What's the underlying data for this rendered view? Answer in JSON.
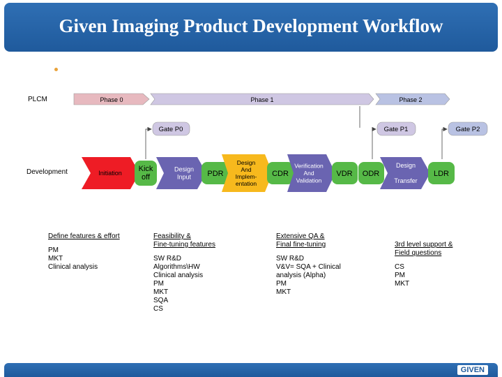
{
  "title": "Given Imaging Product Development Workflow",
  "logo_text": "GIVEN",
  "rows": {
    "plcm": "PLCM",
    "development": "Development"
  },
  "phases": [
    "Phase 0",
    "Phase 1",
    "Phase 2"
  ],
  "gates": [
    "Gate P0",
    "Gate P1",
    "Gate P2"
  ],
  "steps": {
    "initiation": "Initiation",
    "kick_off": "Kick\noff",
    "design_input": "Design\nInput",
    "pdr": "PDR",
    "design_impl": "Design\nAnd\nImplem-\nentation",
    "cdr": "CDR",
    "vv": "Verification\nAnd\nValidation",
    "vdr": "VDR",
    "odr": "ODR",
    "design_transfer": "Design\n \nTransfer",
    "ldr": "LDR"
  },
  "columns": [
    {
      "heading": "Define features & effort",
      "items": [
        "PM",
        "MKT",
        "Clinical analysis"
      ]
    },
    {
      "heading": "Feasibility &\nFine-tuning  features",
      "items": [
        "SW R&D",
        "Algorithms\\HW",
        "Clinical analysis",
        "PM",
        "MKT",
        "SQA",
        "CS"
      ]
    },
    {
      "heading": "Extensive QA &\nFinal fine-tuning",
      "items": [
        "SW R&D",
        "V&V= SQA + Clinical",
        "analysis (Alpha)",
        "PM",
        "MKT"
      ]
    },
    {
      "heading": "3rd level support &\nField questions",
      "items": [
        "CS",
        "PM",
        "MKT"
      ]
    }
  ],
  "colors": {
    "header": "#2f6fb4",
    "phase0": "#e7b9bf",
    "phase1": "#cfc7e3",
    "phase2": "#b9c2e3",
    "initiation": "#ee1c25",
    "kick_off": "#56b947",
    "design_input": "#6a64b1",
    "design_impl": "#f7b91d",
    "cdr": "#56b947",
    "vv": "#6a64b1",
    "vdr": "#56b947",
    "odr": "#56b947",
    "design_transfer": "#6a64b1",
    "ldr": "#56b947"
  }
}
